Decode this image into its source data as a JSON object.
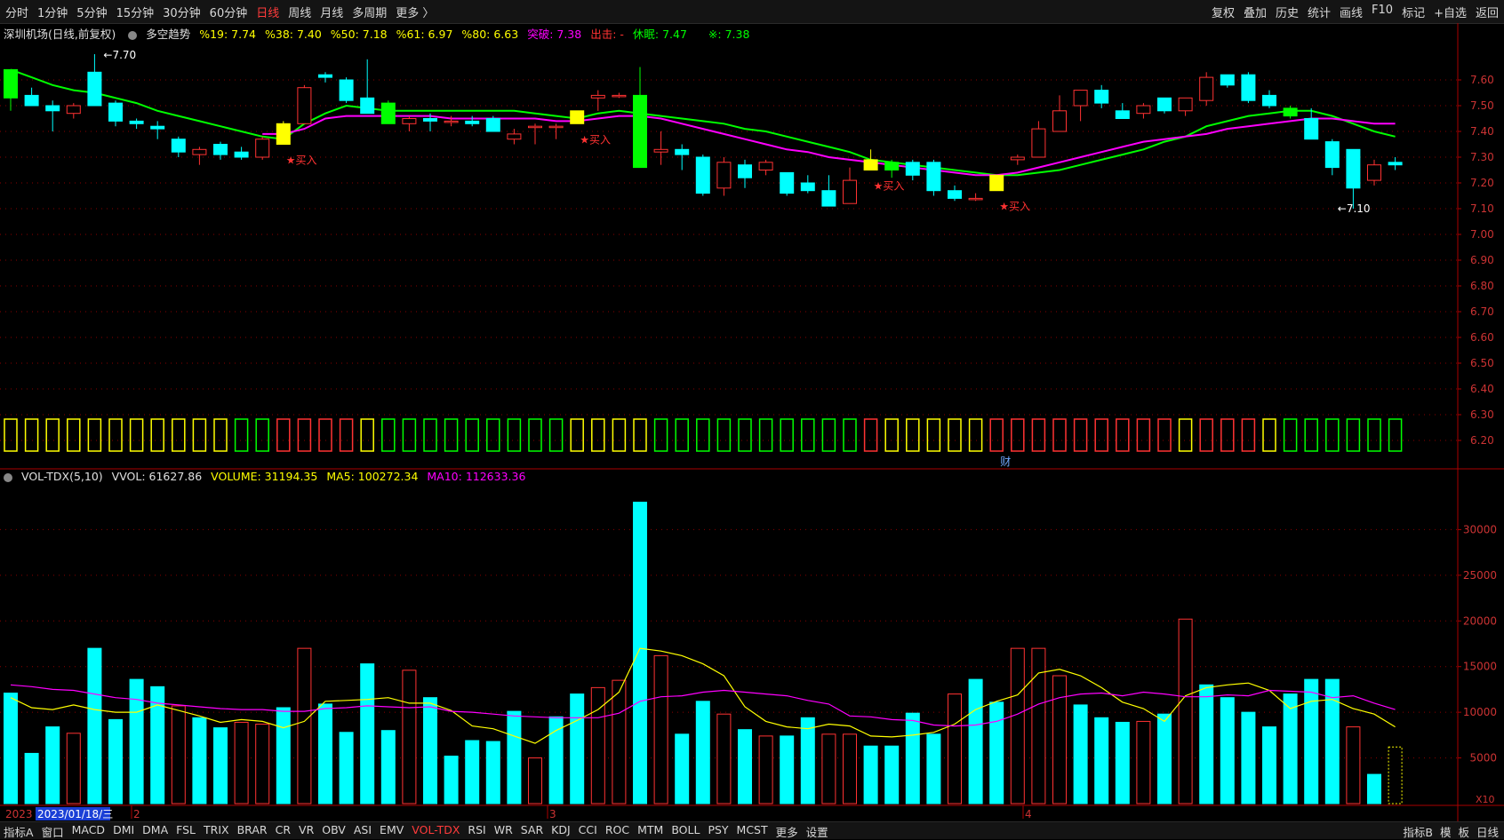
{
  "topbar": {
    "periods": [
      "分时",
      "1分钟",
      "5分钟",
      "15分钟",
      "30分钟",
      "60分钟",
      "日线",
      "周线",
      "月线",
      "多周期",
      "更多 〉"
    ],
    "active_period": "日线",
    "tools": [
      "复权",
      "叠加",
      "历史",
      "统计",
      "画线",
      "F10",
      "标记",
      "+自选",
      "返回"
    ]
  },
  "info": {
    "stock": "深圳机场(日线,前复权)",
    "indicator": "多空趋势",
    "pct19": "%19: 7.74",
    "pct38": "%38: 7.40",
    "pct50": "%50: 7.18",
    "pct61": "%61: 6.97",
    "pct80": "%80: 6.63",
    "breakout": "突破: 7.38",
    "exit": "出击: -",
    "rest": "休眠: 7.47",
    "ma": "※: 7.38"
  },
  "vol_info": {
    "name": "VOL-TDX(5,10)",
    "vvol": "VVOL: 61627.86",
    "volume": "VOLUME: 31194.35",
    "ma5": "MA5: 100272.34",
    "ma10": "MA10: 112633.36"
  },
  "annotations": {
    "high": "7.70",
    "low": "7.10",
    "buy": "★买入",
    "finance": "财",
    "x10": "X10"
  },
  "bottombar": {
    "items": [
      "指标A",
      "窗口",
      "MACD",
      "DMI",
      "DMA",
      "FSL",
      "TRIX",
      "BRAR",
      "CR",
      "VR",
      "OBV",
      "ASI",
      "EMV",
      "VOL-TDX",
      "RSI",
      "WR",
      "SAR",
      "KDJ",
      "CCI",
      "ROC",
      "MTM",
      "BOLL",
      "PSY",
      "MCST",
      "更多",
      "设置"
    ],
    "active": "VOL-TDX",
    "right_items": [
      "指标B",
      "模",
      "板",
      "日线"
    ]
  },
  "colors": {
    "up": "#ff3232",
    "down": "#00ffff",
    "green_line": "#00ff00",
    "magenta_line": "#ff00ff",
    "yellow": "#ffff00",
    "grid": "#8b0000"
  },
  "chart_data": [
    {
      "type": "candlestick",
      "title": "深圳机场(日线,前复权)",
      "y_axis_ticks": [
        "7.60",
        "7.50",
        "7.40",
        "7.30",
        "7.20",
        "7.10",
        "7.00",
        "6.90",
        "6.80",
        "6.70",
        "6.60",
        "6.50",
        "6.40",
        "6.30",
        "6.20"
      ],
      "ylim": [
        6.15,
        7.7
      ],
      "month_markers": [
        "2023",
        "2023/01/18/三",
        "2",
        "3",
        "4"
      ],
      "candles": [
        {
          "o": 7.53,
          "c": 7.64,
          "h": 7.64,
          "l": 7.48,
          "hl": "yg"
        },
        {
          "o": 7.54,
          "c": 7.5,
          "h": 7.57,
          "l": 7.5
        },
        {
          "o": 7.5,
          "c": 7.48,
          "h": 7.52,
          "l": 7.4
        },
        {
          "o": 7.47,
          "c": 7.5,
          "h": 7.51,
          "l": 7.45
        },
        {
          "o": 7.63,
          "c": 7.5,
          "h": 7.7,
          "l": 7.5
        },
        {
          "o": 7.51,
          "c": 7.44,
          "h": 7.52,
          "l": 7.42
        },
        {
          "o": 7.44,
          "c": 7.43,
          "h": 7.45,
          "l": 7.41
        },
        {
          "o": 7.42,
          "c": 7.41,
          "h": 7.44,
          "l": 7.37
        },
        {
          "o": 7.37,
          "c": 7.32,
          "h": 7.38,
          "l": 7.3
        },
        {
          "o": 7.31,
          "c": 7.33,
          "h": 7.34,
          "l": 7.27
        },
        {
          "o": 7.35,
          "c": 7.31,
          "h": 7.36,
          "l": 7.29
        },
        {
          "o": 7.32,
          "c": 7.3,
          "h": 7.34,
          "l": 7.29
        },
        {
          "o": 7.3,
          "c": 7.37,
          "h": 7.38,
          "l": 7.29
        },
        {
          "o": 7.35,
          "c": 7.43,
          "h": 7.44,
          "l": 7.35,
          "hl": "y"
        },
        {
          "o": 7.43,
          "c": 7.57,
          "h": 7.58,
          "l": 7.43
        },
        {
          "o": 7.62,
          "c": 7.61,
          "h": 7.63,
          "l": 7.59
        },
        {
          "o": 7.6,
          "c": 7.52,
          "h": 7.61,
          "l": 7.51
        },
        {
          "o": 7.53,
          "c": 7.47,
          "h": 7.68,
          "l": 7.47
        },
        {
          "o": 7.51,
          "c": 7.43,
          "h": 7.52,
          "l": 7.43,
          "hl": "g"
        },
        {
          "o": 7.43,
          "c": 7.45,
          "h": 7.46,
          "l": 7.4
        },
        {
          "o": 7.45,
          "c": 7.44,
          "h": 7.47,
          "l": 7.4
        },
        {
          "o": 7.44,
          "c": 7.44,
          "h": 7.46,
          "l": 7.42
        },
        {
          "o": 7.44,
          "c": 7.43,
          "h": 7.46,
          "l": 7.42
        },
        {
          "o": 7.45,
          "c": 7.4,
          "h": 7.46,
          "l": 7.4
        },
        {
          "o": 7.37,
          "c": 7.39,
          "h": 7.41,
          "l": 7.35
        },
        {
          "o": 7.42,
          "c": 7.42,
          "h": 7.43,
          "l": 7.35
        },
        {
          "o": 7.42,
          "c": 7.42,
          "h": 7.43,
          "l": 7.37
        },
        {
          "o": 7.43,
          "c": 7.48,
          "h": 7.48,
          "l": 7.43,
          "hl": "y"
        },
        {
          "o": 7.53,
          "c": 7.54,
          "h": 7.56,
          "l": 7.48
        },
        {
          "o": 7.54,
          "c": 7.54,
          "h": 7.55,
          "l": 7.53
        },
        {
          "o": 7.54,
          "c": 7.26,
          "h": 7.65,
          "l": 7.26,
          "hl": "g"
        },
        {
          "o": 7.32,
          "c": 7.33,
          "h": 7.4,
          "l": 7.27
        },
        {
          "o": 7.33,
          "c": 7.31,
          "h": 7.35,
          "l": 7.25
        },
        {
          "o": 7.3,
          "c": 7.16,
          "h": 7.31,
          "l": 7.15
        },
        {
          "o": 7.18,
          "c": 7.28,
          "h": 7.3,
          "l": 7.15
        },
        {
          "o": 7.27,
          "c": 7.22,
          "h": 7.29,
          "l": 7.18
        },
        {
          "o": 7.25,
          "c": 7.28,
          "h": 7.29,
          "l": 7.23
        },
        {
          "o": 7.24,
          "c": 7.16,
          "h": 7.24,
          "l": 7.15
        },
        {
          "o": 7.2,
          "c": 7.17,
          "h": 7.23,
          "l": 7.16
        },
        {
          "o": 7.17,
          "c": 7.11,
          "h": 7.23,
          "l": 7.11
        },
        {
          "o": 7.12,
          "c": 7.21,
          "h": 7.26,
          "l": 7.12
        },
        {
          "o": 7.25,
          "c": 7.29,
          "h": 7.33,
          "l": 7.25,
          "hl": "y"
        },
        {
          "o": 7.28,
          "c": 7.25,
          "h": 7.29,
          "l": 7.22,
          "hl": "g"
        },
        {
          "o": 7.28,
          "c": 7.23,
          "h": 7.29,
          "l": 7.21
        },
        {
          "o": 7.28,
          "c": 7.17,
          "h": 7.29,
          "l": 7.15
        },
        {
          "o": 7.17,
          "c": 7.14,
          "h": 7.19,
          "l": 7.13
        },
        {
          "o": 7.14,
          "c": 7.14,
          "h": 7.16,
          "l": 7.13
        },
        {
          "o": 7.17,
          "c": 7.23,
          "h": 7.23,
          "l": 7.17,
          "hl": "y"
        },
        {
          "o": 7.29,
          "c": 7.3,
          "h": 7.31,
          "l": 7.27
        },
        {
          "o": 7.3,
          "c": 7.41,
          "h": 7.44,
          "l": 7.3
        },
        {
          "o": 7.4,
          "c": 7.48,
          "h": 7.54,
          "l": 7.4
        },
        {
          "o": 7.5,
          "c": 7.56,
          "h": 7.56,
          "l": 7.44
        },
        {
          "o": 7.56,
          "c": 7.51,
          "h": 7.58,
          "l": 7.49
        },
        {
          "o": 7.48,
          "c": 7.45,
          "h": 7.51,
          "l": 7.45
        },
        {
          "o": 7.47,
          "c": 7.5,
          "h": 7.51,
          "l": 7.45
        },
        {
          "o": 7.53,
          "c": 7.48,
          "h": 7.53,
          "l": 7.47
        },
        {
          "o": 7.48,
          "c": 7.53,
          "h": 7.53,
          "l": 7.46
        },
        {
          "o": 7.52,
          "c": 7.61,
          "h": 7.63,
          "l": 7.5
        },
        {
          "o": 7.62,
          "c": 7.58,
          "h": 7.62,
          "l": 7.57
        },
        {
          "o": 7.62,
          "c": 7.52,
          "h": 7.63,
          "l": 7.51
        },
        {
          "o": 7.54,
          "c": 7.5,
          "h": 7.56,
          "l": 7.49
        },
        {
          "o": 7.49,
          "c": 7.46,
          "h": 7.5,
          "l": 7.45,
          "hl": "g"
        },
        {
          "o": 7.45,
          "c": 7.37,
          "h": 7.49,
          "l": 7.37
        },
        {
          "o": 7.36,
          "c": 7.26,
          "h": 7.37,
          "l": 7.23
        },
        {
          "o": 7.33,
          "c": 7.18,
          "h": 7.33,
          "l": 7.1
        },
        {
          "o": 7.21,
          "c": 7.27,
          "h": 7.29,
          "l": 7.19
        },
        {
          "o": 7.28,
          "c": 7.27,
          "h": 7.3,
          "l": 7.25
        }
      ],
      "series": [
        {
          "name": "green",
          "color": "#00ff00",
          "values": [
            7.64,
            7.61,
            7.58,
            7.56,
            7.55,
            7.53,
            7.51,
            7.48,
            7.46,
            7.44,
            7.42,
            7.4,
            7.38,
            7.37,
            7.43,
            7.47,
            7.5,
            7.49,
            7.48,
            7.48,
            7.48,
            7.48,
            7.48,
            7.48,
            7.48,
            7.47,
            7.46,
            7.45,
            7.47,
            7.48,
            7.47,
            7.46,
            7.45,
            7.44,
            7.43,
            7.41,
            7.4,
            7.38,
            7.36,
            7.34,
            7.32,
            7.29,
            7.28,
            7.27,
            7.26,
            7.25,
            7.24,
            7.23,
            7.23,
            7.24,
            7.25,
            7.27,
            7.29,
            7.31,
            7.33,
            7.36,
            7.38,
            7.42,
            7.44,
            7.46,
            7.47,
            7.48,
            7.48,
            7.46,
            7.43,
            7.4,
            7.38
          ]
        },
        {
          "name": "magenta",
          "color": "#ff00ff",
          "values": [
            null,
            null,
            null,
            null,
            null,
            null,
            null,
            null,
            null,
            null,
            null,
            null,
            7.39,
            7.39,
            7.41,
            7.45,
            7.46,
            7.46,
            7.46,
            7.46,
            7.46,
            7.45,
            7.45,
            7.45,
            7.45,
            7.45,
            7.44,
            7.44,
            7.45,
            7.46,
            7.46,
            7.45,
            7.43,
            7.41,
            7.39,
            7.37,
            7.35,
            7.33,
            7.32,
            7.3,
            7.29,
            7.28,
            7.27,
            7.26,
            7.25,
            7.24,
            7.23,
            7.23,
            7.24,
            7.26,
            7.28,
            7.3,
            7.32,
            7.34,
            7.36,
            7.37,
            7.38,
            7.39,
            7.41,
            7.42,
            7.43,
            7.44,
            7.45,
            7.45,
            7.44,
            7.43,
            7.43
          ]
        }
      ],
      "buy_points": [
        13,
        27,
        41,
        47
      ]
    },
    {
      "type": "bar",
      "title": "VOL-TDX(5,10)",
      "y_axis_ticks": [
        "30000",
        "25000",
        "20000",
        "15000",
        "10000",
        "5000"
      ],
      "ylim": [
        0,
        34000
      ],
      "volumes": [
        12100,
        5500,
        8400,
        7700,
        17000,
        9200,
        13600,
        12800,
        10700,
        9400,
        8300,
        8900,
        8700,
        10500,
        17000,
        10900,
        7800,
        15300,
        8000,
        14600,
        11600,
        5200,
        6900,
        6800,
        10100,
        5000,
        9500,
        12000,
        12700,
        13500,
        33000,
        16200,
        7600,
        11200,
        9800,
        8100,
        7400,
        7400,
        9400,
        7600,
        7600,
        6300,
        6300,
        9900,
        7600,
        12000,
        13600,
        11100,
        17000,
        17000,
        14000,
        10800,
        9400,
        8900,
        9000,
        9800,
        20200,
        13000,
        11600,
        10000,
        8400,
        12000,
        13600,
        13600,
        8400,
        3200,
        6200
      ],
      "ma5": [
        11600,
        10500,
        10300,
        10800,
        10300,
        10000,
        10000,
        10800,
        10200,
        9600,
        8900,
        9200,
        9000,
        8300,
        9000,
        11200,
        11300,
        11400,
        11600,
        11000,
        11000,
        10200,
        8500,
        8200,
        7400,
        6600,
        8000,
        9100,
        10300,
        12200,
        17000,
        16700,
        16200,
        15300,
        14000,
        10600,
        9000,
        8400,
        8200,
        8700,
        8500,
        7400,
        7300,
        7500,
        7800,
        8700,
        10300,
        11200,
        11900,
        14300,
        14700,
        14000,
        12700,
        11100,
        10400,
        9000,
        11800,
        12700,
        13000,
        13200,
        12400,
        10400,
        11200,
        11400,
        10400,
        9800,
        8400
      ],
      "ma10": [
        13000,
        12800,
        12500,
        12400,
        12000,
        11600,
        11400,
        11000,
        10800,
        10600,
        10400,
        10300,
        10300,
        10100,
        10100,
        10400,
        10500,
        10700,
        10600,
        10500,
        10600,
        10100,
        10000,
        9800,
        9600,
        9500,
        9400,
        9400,
        9400,
        9900,
        11200,
        11700,
        11800,
        12200,
        12400,
        12200,
        12000,
        11800,
        11300,
        10900,
        9600,
        9500,
        9200,
        9100,
        8600,
        8500,
        8600,
        9000,
        9800,
        10900,
        11600,
        12000,
        12100,
        11800,
        12200,
        12000,
        11700,
        11700,
        11900,
        11800,
        12400,
        12300,
        12200,
        11600,
        11800,
        11000,
        10300
      ],
      "volume_colors": [
        "c",
        "c",
        "c",
        "r",
        "c",
        "c",
        "c",
        "c",
        "r",
        "c",
        "c",
        "r",
        "r",
        "c",
        "r",
        "c",
        "c",
        "c",
        "c",
        "r",
        "c",
        "c",
        "c",
        "c",
        "c",
        "r",
        "c",
        "c",
        "r",
        "r",
        "c",
        "r",
        "c",
        "c",
        "r",
        "c",
        "r",
        "c",
        "c",
        "r",
        "r",
        "c",
        "c",
        "c",
        "c",
        "r",
        "c",
        "c",
        "r",
        "r",
        "r",
        "c",
        "c",
        "c",
        "r",
        "c",
        "r",
        "c",
        "c",
        "c",
        "c",
        "c",
        "c",
        "c",
        "r",
        "c",
        "y"
      ]
    }
  ],
  "signal_boxes": [
    "y",
    "y",
    "y",
    "y",
    "y",
    "y",
    "y",
    "y",
    "y",
    "y",
    "y",
    "g",
    "g",
    "r",
    "r",
    "r",
    "r",
    "y",
    "g",
    "g",
    "g",
    "g",
    "g",
    "g",
    "g",
    "g",
    "g",
    "y",
    "y",
    "y",
    "y",
    "g",
    "g",
    "g",
    "g",
    "g",
    "g",
    "g",
    "g",
    "g",
    "g",
    "r",
    "y",
    "y",
    "y",
    "y",
    "y",
    "r",
    "r",
    "r",
    "r",
    "r",
    "r",
    "r",
    "r",
    "r",
    "y",
    "r",
    "r",
    "r",
    "y",
    "g",
    "g",
    "g",
    "g",
    "g",
    "g"
  ]
}
